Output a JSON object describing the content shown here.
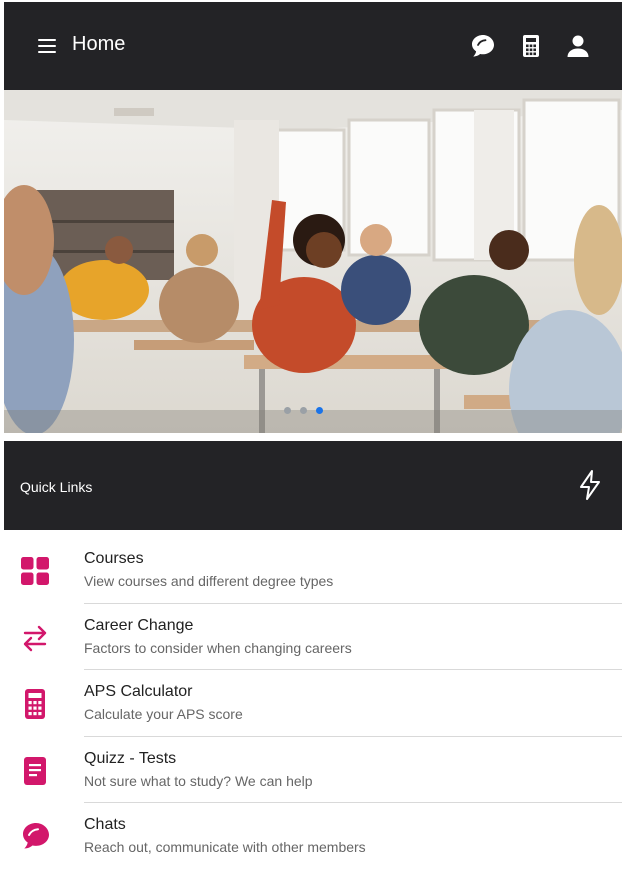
{
  "header": {
    "title": "Home",
    "icons": [
      "chat-icon",
      "calculator-icon",
      "profile-icon"
    ]
  },
  "carousel": {
    "slide_count": 3,
    "active_index": 2
  },
  "quick_links": {
    "label": "Quick Links",
    "icon": "lightning-icon"
  },
  "menu": {
    "items": [
      {
        "title": "Courses",
        "subtitle": "View courses and different degree types",
        "icon": "grid-icon"
      },
      {
        "title": "Career Change",
        "subtitle": "Factors to consider when changing careers",
        "icon": "swap-arrows-icon"
      },
      {
        "title": "APS Calculator",
        "subtitle": "Calculate your APS score",
        "icon": "calculator-icon"
      },
      {
        "title": "Quizz - Tests",
        "subtitle": "Not sure what to study? We can help",
        "icon": "document-icon"
      },
      {
        "title": "Chats",
        "subtitle": "Reach out, communicate with other members",
        "icon": "chat-icon"
      }
    ]
  },
  "colors": {
    "header_bg": "#232326",
    "accent": "#d2176b",
    "active_dot": "#1a73e8"
  }
}
